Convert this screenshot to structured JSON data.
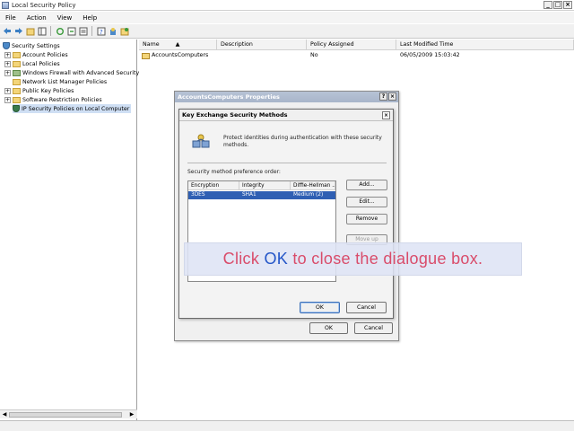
{
  "window": {
    "title": "Local Security Policy",
    "controls": [
      "_",
      "□",
      "×"
    ]
  },
  "menu": [
    "File",
    "Action",
    "View",
    "Help"
  ],
  "toolbar": {
    "icons": [
      "back-icon",
      "forward-icon",
      "up-icon",
      "show-hide-tree-icon",
      "refresh-icon",
      "export-icon",
      "properties-icon",
      "help-icon",
      "assign-icon",
      "new-policy-icon"
    ]
  },
  "tree": {
    "root": "Security Settings",
    "items": [
      "Account Policies",
      "Local Policies",
      "Windows Firewall with Advanced Security",
      "Network List Manager Policies",
      "Public Key Policies",
      "Software Restriction Policies",
      "IP Security Policies on Local Computer"
    ]
  },
  "list": {
    "columns": [
      "Name",
      "Description",
      "Policy Assigned",
      "Last Modified Time"
    ],
    "rows": [
      {
        "name": "AccountsComputers",
        "description": "",
        "assigned": "No",
        "modified": "06/05/2009 15:03:42"
      }
    ]
  },
  "props_dialog": {
    "title": "AccountsComputers Properties",
    "help": "?",
    "close": "×",
    "ok": "OK",
    "cancel": "Cancel"
  },
  "kx_dialog": {
    "title": "Key Exchange Security Methods",
    "close": "×",
    "description": "Protect identities during authentication with these security methods.",
    "list_label": "Security method preference order:",
    "columns": [
      "Encryption",
      "Integrity",
      "Diffie-Hellman ..."
    ],
    "rows": [
      {
        "encryption": "3DES",
        "integrity": "SHA1",
        "dh": "Medium (2)"
      }
    ],
    "buttons": {
      "add": "Add...",
      "edit": "Edit...",
      "remove": "Remove",
      "move_up": "Move up",
      "ok": "OK",
      "cancel": "Cancel"
    }
  },
  "overlay": {
    "before": "Click ",
    "ok": "OK",
    "after": " to close the dialogue box."
  },
  "colors": {
    "selection": "#2f5fb3",
    "overlay_text": "#d94c6a",
    "overlay_highlight": "#2456c8"
  }
}
